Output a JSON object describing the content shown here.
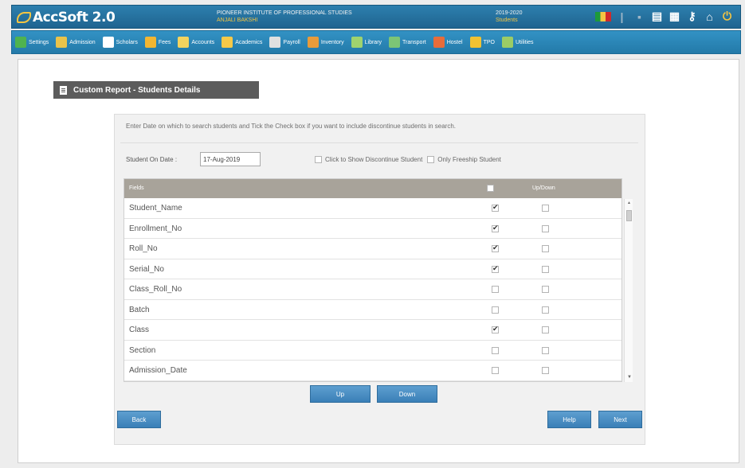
{
  "header": {
    "app_name": "AccSoft 2.0",
    "institute_name": "PIONEER INSTITUTE OF PROFESSIONAL STUDIES",
    "institute_sub": "ANJALI BAKSHI",
    "session": "2019-2020",
    "session_sub": "Students"
  },
  "menu": {
    "items": [
      {
        "label": "Settings",
        "icon": "gear-icon",
        "color": "#4fb34f"
      },
      {
        "label": "Admission",
        "icon": "admission-icon",
        "color": "#e9c34a"
      },
      {
        "label": "Scholars",
        "icon": "scholars-icon",
        "color": "#ffffff"
      },
      {
        "label": "Fees",
        "icon": "fees-icon",
        "color": "#f2b632"
      },
      {
        "label": "Accounts",
        "icon": "accounts-icon",
        "color": "#f4d35e"
      },
      {
        "label": "Academics",
        "icon": "academics-icon",
        "color": "#f7c948"
      },
      {
        "label": "Payroll",
        "icon": "payroll-icon",
        "color": "#e0e0e0"
      },
      {
        "label": "Inventory",
        "icon": "inventory-icon",
        "color": "#e89b3a"
      },
      {
        "label": "Library",
        "icon": "library-icon",
        "color": "#9fd36e"
      },
      {
        "label": "Transport",
        "icon": "transport-icon",
        "color": "#7cc576"
      },
      {
        "label": "Hostel",
        "icon": "hostel-icon",
        "color": "#e86c3a"
      },
      {
        "label": "TPO",
        "icon": "tpo-icon",
        "color": "#f1c232"
      },
      {
        "label": "Utilities",
        "icon": "utilities-icon",
        "color": "#9ccc65"
      }
    ]
  },
  "report": {
    "title": "Custom Report - Students Details",
    "instruction": "Enter Date on which to search students and Tick the Check box if you want to include discontinue students in search.",
    "date_label": "Student On Date :",
    "date_value": "17-Aug-2019",
    "discontinue_label": "Click to Show Discontinue Student",
    "freeship_label": "Only Freeship Student"
  },
  "grid": {
    "columns": {
      "name": "Fields",
      "updown": "Up/Down"
    },
    "rows": [
      {
        "name": "Student_Name",
        "checked": true
      },
      {
        "name": "Enrollment_No",
        "checked": true
      },
      {
        "name": "Roll_No",
        "checked": true
      },
      {
        "name": "Serial_No",
        "checked": true
      },
      {
        "name": "Class_Roll_No",
        "checked": false
      },
      {
        "name": "Batch",
        "checked": false
      },
      {
        "name": "Class",
        "checked": true
      },
      {
        "name": "Section",
        "checked": false
      },
      {
        "name": "Admission_Date",
        "checked": false
      }
    ]
  },
  "buttons": {
    "up": "Up",
    "down": "Down",
    "back": "Back",
    "help": "Help",
    "next": "Next"
  }
}
